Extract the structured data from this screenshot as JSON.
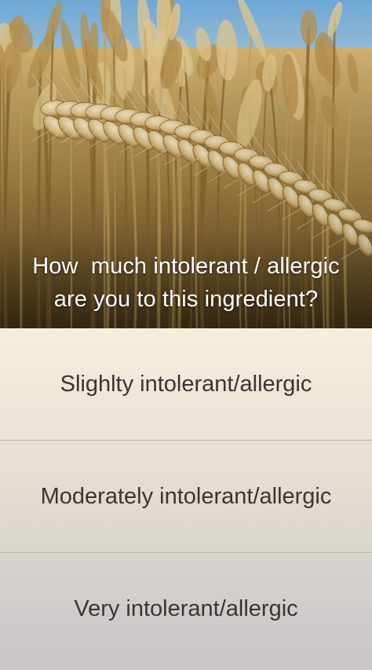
{
  "question": {
    "line1": "How  much intolerant / allergic",
    "line2": "are you to this ingredient?"
  },
  "options": [
    {
      "label": "Slighlty intolerant/allergic"
    },
    {
      "label": "Moderately intolerant/allergic"
    },
    {
      "label": "Very intolerant/allergic"
    }
  ],
  "colors": {
    "sky": "#8fbbdb",
    "wheat": "#c9a560",
    "options_top": "#f6efdd",
    "options_bottom": "#c9c5c8",
    "option_text": "#3a3533",
    "divider": "#b9b3ab"
  }
}
